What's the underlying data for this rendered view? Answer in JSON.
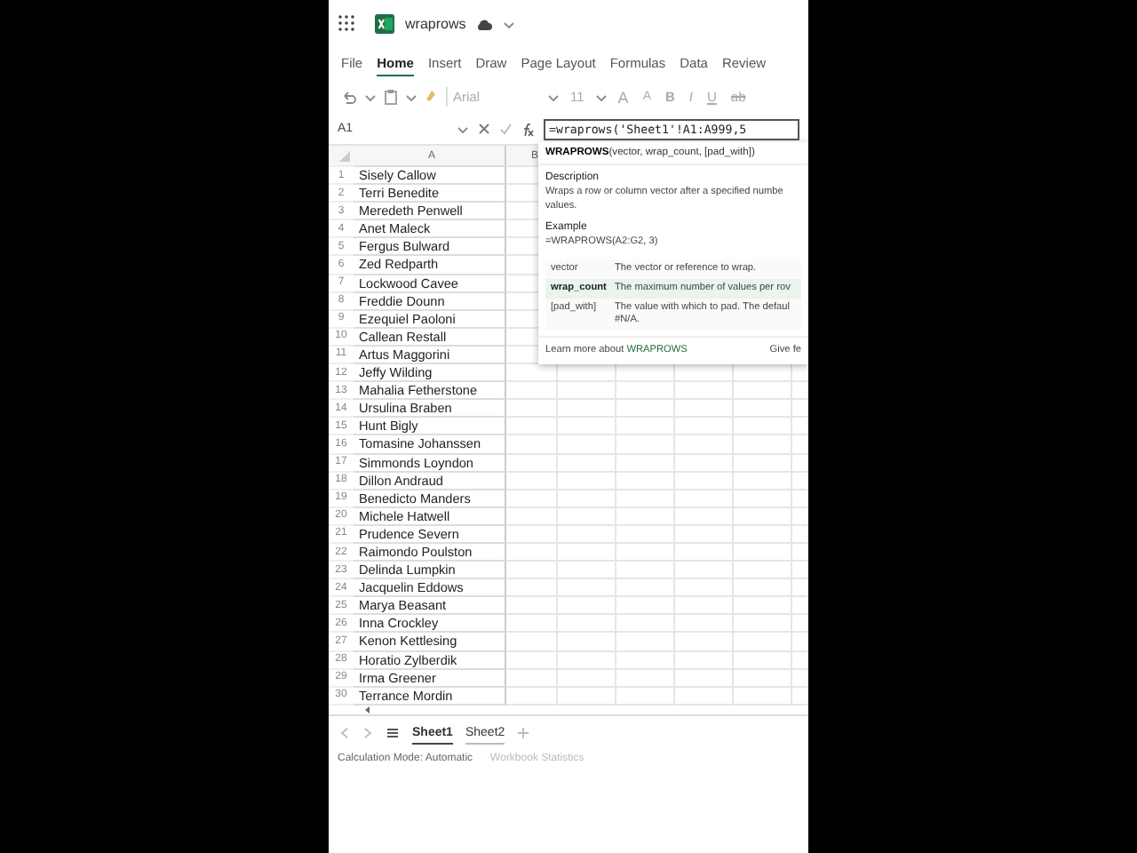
{
  "title_bar": {
    "file_name": "wraprows"
  },
  "ribbon_tabs": [
    {
      "label": "File",
      "selected": false
    },
    {
      "label": "Home",
      "selected": true
    },
    {
      "label": "Insert",
      "selected": false
    },
    {
      "label": "Draw",
      "selected": false
    },
    {
      "label": "Page Layout",
      "selected": false
    },
    {
      "label": "Formulas",
      "selected": false
    },
    {
      "label": "Data",
      "selected": false
    },
    {
      "label": "Review",
      "selected": false
    }
  ],
  "toolbar": {
    "disabled": true,
    "font": "Arial",
    "size": "11",
    "format_buttons": [
      {
        "label": "A",
        "kind": "grow"
      },
      {
        "label": "A",
        "kind": "shrink"
      },
      {
        "label": "B",
        "kind": "bold"
      },
      {
        "label": "I",
        "kind": "italic"
      },
      {
        "label": "U",
        "kind": "underline"
      },
      {
        "label": "ab",
        "kind": "strike"
      }
    ]
  },
  "formula_bar": {
    "name_box": "A1",
    "formula": "=wraprows('Sheet1'!A1:A999,5"
  },
  "columns": [
    "A",
    "B"
  ],
  "rows": [
    {
      "number": "1",
      "name": "Sisely Callow"
    },
    {
      "number": "2",
      "name": "Terri Benedite"
    },
    {
      "number": "3",
      "name": "Meredeth Penwell"
    },
    {
      "number": "4",
      "name": "Anet Maleck"
    },
    {
      "number": "5",
      "name": "Fergus Bulward"
    },
    {
      "number": "6",
      "name": "Zed Redparth"
    },
    {
      "number": "7",
      "name": "Lockwood Cavee"
    },
    {
      "number": "8",
      "name": "Freddie Dounn"
    },
    {
      "number": "9",
      "name": "Ezequiel Paoloni"
    },
    {
      "number": "10",
      "name": "Callean Restall"
    },
    {
      "number": "11",
      "name": "Artus Maggorini"
    },
    {
      "number": "12",
      "name": "Jeffy Wilding"
    },
    {
      "number": "13",
      "name": "Mahalia Fetherstone"
    },
    {
      "number": "14",
      "name": "Ursulina Braben"
    },
    {
      "number": "15",
      "name": "Hunt Bigly"
    },
    {
      "number": "16",
      "name": "Tomasine Johanssen"
    },
    {
      "number": "17",
      "name": "Simmonds Loyndon"
    },
    {
      "number": "18",
      "name": "Dillon Andraud"
    },
    {
      "number": "19",
      "name": "Benedicto Manders"
    },
    {
      "number": "20",
      "name": "Michele Hatwell"
    },
    {
      "number": "21",
      "name": "Prudence Severn"
    },
    {
      "number": "22",
      "name": "Raimondo Poulston"
    },
    {
      "number": "23",
      "name": "Delinda Lumpkin"
    },
    {
      "number": "24",
      "name": "Jacquelin Eddows"
    },
    {
      "number": "25",
      "name": "Marya Beasant"
    },
    {
      "number": "26",
      "name": "Inna Crockley"
    },
    {
      "number": "27",
      "name": "Kenon Kettlesing"
    },
    {
      "number": "28",
      "name": "Horatio Zylberdik"
    },
    {
      "number": "29",
      "name": "Irma Greener"
    },
    {
      "number": "30",
      "name": "Terrance Mordin"
    }
  ],
  "tooltip": {
    "signature": "**WRAPROWS**(vector, wrap_count, [pad_with])",
    "description_heading": "Description",
    "description_lines": [
      "Wraps a row or column vector after a specified numbe",
      "values."
    ],
    "example_heading": "Example",
    "example": "=WRAPROWS(A2:G2, 3)",
    "arguments": [
      {
        "name": "vector",
        "text": [
          "The vector or reference to wrap."
        ],
        "selected": false
      },
      {
        "name": "wrap_count",
        "text": [
          "The maximum number of values per rov"
        ],
        "selected": true
      },
      {
        "name": "[pad_with]",
        "text": [
          "The value with which to pad. The defaul",
          "#N/A."
        ],
        "selected": false
      }
    ],
    "learn_more": "Learn more about **WRAPROWS**",
    "feedback": "Give fe"
  },
  "sheet_tabs": [
    {
      "label": "Sheet1",
      "selected": true
    },
    {
      "label": "Sheet2",
      "selected": false
    }
  ],
  "status_bar": {
    "calc_mode": "Calculation Mode: Automatic",
    "stats": "Workbook Statistics"
  }
}
